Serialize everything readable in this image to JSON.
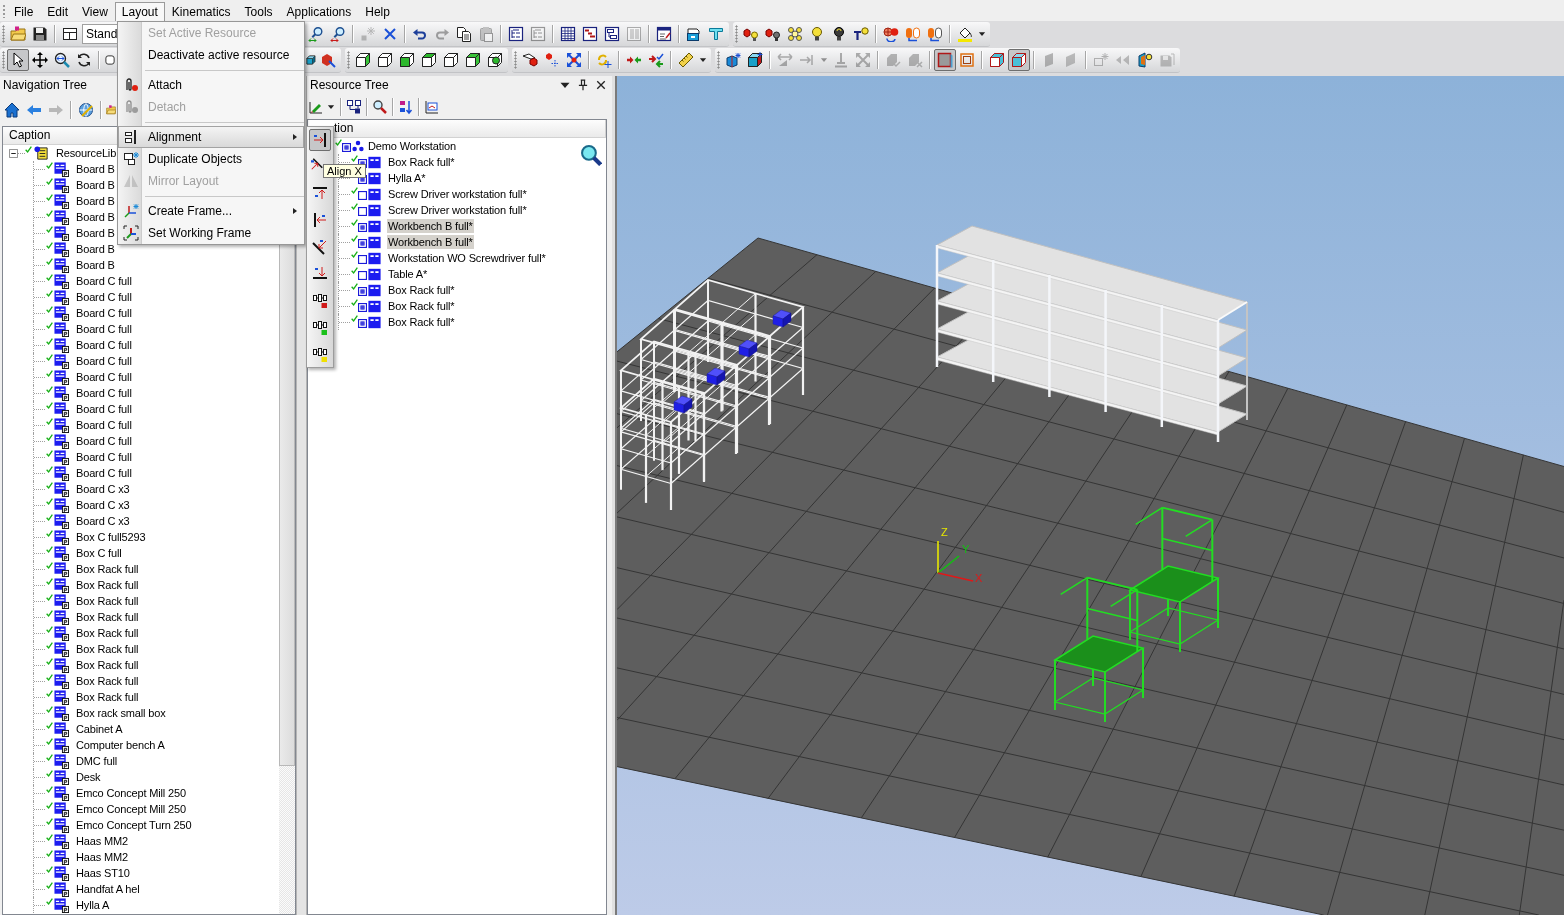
{
  "menu_bar": {
    "items": [
      {
        "label": "File",
        "selected": false
      },
      {
        "label": "Edit",
        "selected": false
      },
      {
        "label": "View",
        "selected": false
      },
      {
        "label": "Layout",
        "selected": true
      },
      {
        "label": "Kinematics",
        "selected": false
      },
      {
        "label": "Tools",
        "selected": false
      },
      {
        "label": "Applications",
        "selected": false
      },
      {
        "label": "Help",
        "selected": false
      }
    ]
  },
  "toolbar_rows": [
    [
      {
        "items": [
          {
            "kind": "grip"
          },
          {
            "kind": "button",
            "disabled": false,
            "pressed": false
          },
          {
            "kind": "button",
            "disabled": false,
            "pressed": false
          },
          {
            "kind": "separator"
          },
          {
            "kind": "button",
            "disabled": false,
            "pressed": false
          },
          {
            "kind": "combo",
            "value": "Stand"
          }
        ]
      },
      {
        "items": [
          {
            "kind": "button",
            "disabled": false,
            "pressed": false
          },
          {
            "kind": "button",
            "disabled": false,
            "pressed": false
          },
          {
            "kind": "separator"
          },
          {
            "kind": "button",
            "disabled": true,
            "pressed": false
          },
          {
            "kind": "button",
            "disabled": false,
            "pressed": false
          },
          {
            "kind": "separator"
          },
          {
            "kind": "button",
            "disabled": false,
            "pressed": false
          },
          {
            "kind": "button",
            "disabled": true,
            "pressed": false
          },
          {
            "kind": "button",
            "disabled": false,
            "pressed": false
          },
          {
            "kind": "button",
            "disabled": true,
            "pressed": false
          },
          {
            "kind": "separator"
          },
          {
            "kind": "button",
            "disabled": false,
            "pressed": false
          },
          {
            "kind": "button",
            "disabled": true,
            "pressed": false
          },
          {
            "kind": "separator"
          },
          {
            "kind": "button",
            "disabled": false,
            "pressed": false
          },
          {
            "kind": "button",
            "disabled": false,
            "pressed": false
          },
          {
            "kind": "button",
            "disabled": false,
            "pressed": false
          },
          {
            "kind": "button",
            "disabled": true,
            "pressed": false
          },
          {
            "kind": "separator"
          },
          {
            "kind": "button",
            "disabled": false,
            "pressed": false
          },
          {
            "kind": "separator"
          },
          {
            "kind": "button",
            "disabled": false,
            "pressed": false
          },
          {
            "kind": "button",
            "disabled": false,
            "pressed": false
          }
        ]
      },
      {
        "items": [
          {
            "kind": "grip"
          },
          {
            "kind": "button",
            "disabled": false,
            "pressed": false
          },
          {
            "kind": "button",
            "disabled": false,
            "pressed": false
          },
          {
            "kind": "button",
            "disabled": false,
            "pressed": false
          },
          {
            "kind": "button",
            "disabled": false,
            "pressed": false
          },
          {
            "kind": "button",
            "disabled": false,
            "pressed": false
          },
          {
            "kind": "button",
            "disabled": false,
            "pressed": false
          },
          {
            "kind": "separator"
          },
          {
            "kind": "button",
            "disabled": false,
            "pressed": false
          },
          {
            "kind": "button",
            "disabled": false,
            "pressed": false
          },
          {
            "kind": "button",
            "disabled": false,
            "pressed": false
          },
          {
            "kind": "separator"
          },
          {
            "kind": "button",
            "disabled": false,
            "pressed": false
          },
          {
            "kind": "dropdown",
            "disabled": false
          }
        ]
      }
    ],
    [
      {
        "items": [
          {
            "kind": "grip"
          },
          {
            "kind": "button",
            "disabled": false,
            "pressed": true
          },
          {
            "kind": "button",
            "disabled": false,
            "pressed": false
          },
          {
            "kind": "button",
            "disabled": false,
            "pressed": false
          },
          {
            "kind": "button",
            "disabled": false,
            "pressed": false
          },
          {
            "kind": "separator"
          },
          {
            "kind": "button",
            "disabled": false,
            "pressed": false
          }
        ]
      },
      {
        "items": [
          {
            "kind": "button",
            "disabled": false,
            "pressed": false
          },
          {
            "kind": "button",
            "disabled": false,
            "pressed": false
          }
        ]
      },
      {
        "items": [
          {
            "kind": "grip"
          },
          {
            "kind": "button",
            "disabled": false,
            "pressed": false
          },
          {
            "kind": "button",
            "disabled": false,
            "pressed": false
          },
          {
            "kind": "button",
            "disabled": false,
            "pressed": false
          },
          {
            "kind": "button",
            "disabled": false,
            "pressed": false
          },
          {
            "kind": "button",
            "disabled": false,
            "pressed": false
          },
          {
            "kind": "button",
            "disabled": false,
            "pressed": false
          },
          {
            "kind": "button",
            "disabled": false,
            "pressed": false
          }
        ]
      },
      {
        "items": [
          {
            "kind": "grip"
          },
          {
            "kind": "button",
            "disabled": false,
            "pressed": false
          },
          {
            "kind": "button",
            "disabled": false,
            "pressed": false
          },
          {
            "kind": "button",
            "disabled": false,
            "pressed": false
          },
          {
            "kind": "separator"
          },
          {
            "kind": "button",
            "disabled": false,
            "pressed": false
          },
          {
            "kind": "separator"
          },
          {
            "kind": "button",
            "disabled": false,
            "pressed": false
          },
          {
            "kind": "button",
            "disabled": false,
            "pressed": false
          },
          {
            "kind": "separator"
          },
          {
            "kind": "button",
            "disabled": false,
            "pressed": false
          },
          {
            "kind": "dropdown",
            "disabled": false
          }
        ]
      },
      {
        "items": [
          {
            "kind": "grip"
          },
          {
            "kind": "button",
            "disabled": false,
            "pressed": false
          },
          {
            "kind": "button",
            "disabled": false,
            "pressed": false
          },
          {
            "kind": "separator"
          },
          {
            "kind": "button",
            "disabled": true,
            "pressed": false
          },
          {
            "kind": "button",
            "disabled": true,
            "pressed": false
          },
          {
            "kind": "dropdown",
            "disabled": true
          },
          {
            "kind": "button",
            "disabled": true,
            "pressed": false
          },
          {
            "kind": "button",
            "disabled": true,
            "pressed": false
          },
          {
            "kind": "separator"
          },
          {
            "kind": "button",
            "disabled": true,
            "pressed": false
          },
          {
            "kind": "button",
            "disabled": true,
            "pressed": false
          },
          {
            "kind": "separator"
          },
          {
            "kind": "button",
            "disabled": false,
            "pressed": true
          },
          {
            "kind": "button",
            "disabled": false,
            "pressed": false
          },
          {
            "kind": "separator"
          },
          {
            "kind": "button",
            "disabled": false,
            "pressed": false
          },
          {
            "kind": "button",
            "disabled": false,
            "pressed": true
          },
          {
            "kind": "separator"
          },
          {
            "kind": "button",
            "disabled": true,
            "pressed": false
          },
          {
            "kind": "button",
            "disabled": true,
            "pressed": false
          },
          {
            "kind": "separator"
          },
          {
            "kind": "button",
            "disabled": true,
            "pressed": false
          },
          {
            "kind": "button",
            "disabled": true,
            "pressed": false
          },
          {
            "kind": "button",
            "disabled": false,
            "pressed": false
          },
          {
            "kind": "button",
            "disabled": true,
            "pressed": false
          }
        ]
      }
    ]
  ],
  "navigation_tree": {
    "title": "Navigation Tree",
    "toolbar": [
      {
        "kind": "button",
        "disabled": false,
        "pressed": false
      },
      {
        "kind": "button",
        "disabled": false,
        "pressed": false
      },
      {
        "kind": "button",
        "disabled": true,
        "pressed": false
      },
      {
        "kind": "separator"
      },
      {
        "kind": "button",
        "disabled": false,
        "pressed": false
      },
      {
        "kind": "separator"
      },
      {
        "kind": "button",
        "disabled": false,
        "pressed": false
      }
    ],
    "header": "Caption",
    "root": {
      "label": "ResourceLib",
      "expanded": true,
      "checked": true,
      "children": [
        {
          "label": "Board B",
          "checked": true
        },
        {
          "label": "Board B",
          "checked": true
        },
        {
          "label": "Board B",
          "checked": true
        },
        {
          "label": "Board B",
          "checked": true
        },
        {
          "label": "Board B",
          "checked": true
        },
        {
          "label": "Board B",
          "checked": true
        },
        {
          "label": "Board B",
          "checked": true
        },
        {
          "label": "Board C full",
          "checked": true
        },
        {
          "label": "Board C full",
          "checked": true
        },
        {
          "label": "Board C full",
          "checked": true
        },
        {
          "label": "Board C full",
          "checked": true
        },
        {
          "label": "Board C full",
          "checked": true
        },
        {
          "label": "Board C full",
          "checked": true
        },
        {
          "label": "Board C full",
          "checked": true
        },
        {
          "label": "Board C full",
          "checked": true
        },
        {
          "label": "Board C full",
          "checked": true
        },
        {
          "label": "Board C full",
          "checked": true
        },
        {
          "label": "Board C full",
          "checked": true
        },
        {
          "label": "Board C full",
          "checked": true
        },
        {
          "label": "Board C full",
          "checked": true
        },
        {
          "label": "Board C x3",
          "checked": true
        },
        {
          "label": "Board C x3",
          "checked": true
        },
        {
          "label": "Board C x3",
          "checked": true
        },
        {
          "label": "Box C full5293",
          "checked": true
        },
        {
          "label": "Box C full",
          "checked": true
        },
        {
          "label": "Box Rack full",
          "checked": true
        },
        {
          "label": "Box Rack full",
          "checked": true
        },
        {
          "label": "Box Rack full",
          "checked": true
        },
        {
          "label": "Box Rack full",
          "checked": true
        },
        {
          "label": "Box Rack full",
          "checked": true
        },
        {
          "label": "Box Rack full",
          "checked": true
        },
        {
          "label": "Box Rack full",
          "checked": true
        },
        {
          "label": "Box Rack full",
          "checked": true
        },
        {
          "label": "Box Rack full",
          "checked": true
        },
        {
          "label": "Box rack small box",
          "checked": true
        },
        {
          "label": "Cabinet A",
          "checked": true
        },
        {
          "label": "Computer bench A",
          "checked": true
        },
        {
          "label": "DMC full",
          "checked": true
        },
        {
          "label": "Desk",
          "checked": true
        },
        {
          "label": "Emco Concept Mill 250",
          "checked": true
        },
        {
          "label": "Emco Concept Mill 250",
          "checked": true
        },
        {
          "label": "Emco Concept Turn 250",
          "checked": true
        },
        {
          "label": "Haas MM2",
          "checked": true
        },
        {
          "label": "Haas MM2",
          "checked": true
        },
        {
          "label": "Haas ST10",
          "checked": true
        },
        {
          "label": "Handfat A hel",
          "checked": true
        },
        {
          "label": "Hylla A",
          "checked": true
        }
      ]
    }
  },
  "resource_tree": {
    "title": "Resource Tree",
    "toolbar": [
      {
        "kind": "button",
        "disabled": false,
        "pressed": false
      },
      {
        "kind": "dropdown",
        "disabled": false
      },
      {
        "kind": "separator"
      },
      {
        "kind": "button",
        "disabled": false,
        "pressed": false
      },
      {
        "kind": "separator"
      },
      {
        "kind": "button",
        "disabled": false,
        "pressed": false
      },
      {
        "kind": "separator"
      },
      {
        "kind": "button",
        "disabled": false,
        "pressed": false
      },
      {
        "kind": "separator"
      },
      {
        "kind": "button",
        "disabled": false,
        "pressed": false
      }
    ],
    "header": "tion",
    "root": {
      "label": "Demo Workstation",
      "checked": true,
      "shown": true,
      "children": [
        {
          "label": "Box Rack full*",
          "checked": true,
          "shown": true,
          "selected": false
        },
        {
          "label": "Hylla A*",
          "shown": true,
          "selected": false
        },
        {
          "label": "Screw Driver workstation full*",
          "checked": true,
          "shown": false,
          "selected": false
        },
        {
          "label": "Screw Driver workstation full*",
          "checked": true,
          "shown": false,
          "selected": false
        },
        {
          "label": "Workbench B full*",
          "checked": true,
          "shown": true,
          "selected": true
        },
        {
          "label": "Workbench B full*",
          "checked": true,
          "shown": true,
          "selected": true
        },
        {
          "label": "Workstation WO Screwdriver full*",
          "checked": true,
          "shown": false,
          "selected": false
        },
        {
          "label": "Table A*",
          "checked": true,
          "shown": false,
          "selected": false
        },
        {
          "label": "Box Rack full*",
          "checked": true,
          "shown": true,
          "selected": false
        },
        {
          "label": "Box Rack full*",
          "checked": true,
          "shown": true,
          "selected": false
        },
        {
          "label": "Box Rack full*",
          "checked": true,
          "shown": true,
          "selected": false
        }
      ]
    }
  },
  "viewport": {
    "axes": [
      {
        "label": "Z"
      },
      {
        "label": "Y"
      },
      {
        "label": "X"
      }
    ]
  },
  "layout_menu": {
    "items": [
      {
        "kind": "item",
        "label": "Set Active Resource",
        "disabled": true,
        "selected": false,
        "submenu": false
      },
      {
        "kind": "item",
        "label": "Deactivate active resource",
        "disabled": false,
        "selected": false,
        "submenu": false
      },
      {
        "kind": "separator"
      },
      {
        "kind": "item",
        "label": "Attach",
        "disabled": false,
        "selected": false,
        "submenu": false
      },
      {
        "kind": "item",
        "label": "Detach",
        "disabled": true,
        "selected": false,
        "submenu": false
      },
      {
        "kind": "separator"
      },
      {
        "kind": "item",
        "label": "Alignment",
        "disabled": false,
        "selected": true,
        "submenu": true
      },
      {
        "kind": "item",
        "label": "Duplicate Objects",
        "disabled": false,
        "selected": false,
        "submenu": false
      },
      {
        "kind": "item",
        "label": "Mirror Layout",
        "disabled": true,
        "selected": false,
        "submenu": false
      },
      {
        "kind": "separator"
      },
      {
        "kind": "item",
        "label": "Create Frame...",
        "disabled": false,
        "selected": false,
        "submenu": true
      },
      {
        "kind": "item",
        "label": "Set Working Frame",
        "disabled": false,
        "selected": false,
        "submenu": false
      }
    ]
  },
  "alignment_submenu": {
    "items": [
      {
        "selected": true
      },
      {
        "selected": false
      },
      {
        "selected": false
      },
      {
        "selected": false
      },
      {
        "selected": false
      },
      {
        "selected": false
      },
      {
        "selected": false
      },
      {
        "selected": false
      },
      {
        "selected": false
      }
    ],
    "tooltip": "Align X"
  }
}
